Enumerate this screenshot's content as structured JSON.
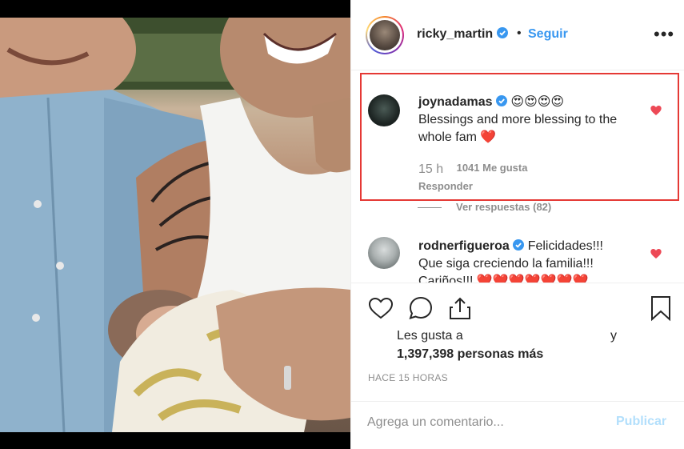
{
  "post": {
    "owner_username": "ricky_martin",
    "separator": "•",
    "follow_label": "Seguir",
    "more_icon": "more-options-icon",
    "more_label": "•••"
  },
  "comments": [
    {
      "username": "joynadamas",
      "verified": true,
      "emoji": "😍😍😍😍",
      "text": "Blessings and more blessing to the whole fam ❤️",
      "time": "15 h",
      "likes": "1041 Me gusta",
      "reply_label": "Responder",
      "view_replies": "Ver respuestas (82)",
      "liked": true
    },
    {
      "username": "rodnerfigueroa",
      "verified": true,
      "text": "Felicidades!!! Que siga creciendo la familia!!! Cariños!!! ❤️❤️❤️❤️❤️❤️❤️",
      "liked": true
    }
  ],
  "actions": {
    "likes_prefix": "Les gusta a",
    "likes_suffix": "y",
    "likes_count": "1,397,398 personas más",
    "timestamp": "HACE 15 HORAS"
  },
  "comment_box": {
    "placeholder": "Agrega un comentario...",
    "publish_label": "Publicar"
  },
  "colors": {
    "accent": "#3897f0",
    "heart": "#ed4956",
    "highlight": "#e53935",
    "publish_disabled": "#b2dffc"
  }
}
